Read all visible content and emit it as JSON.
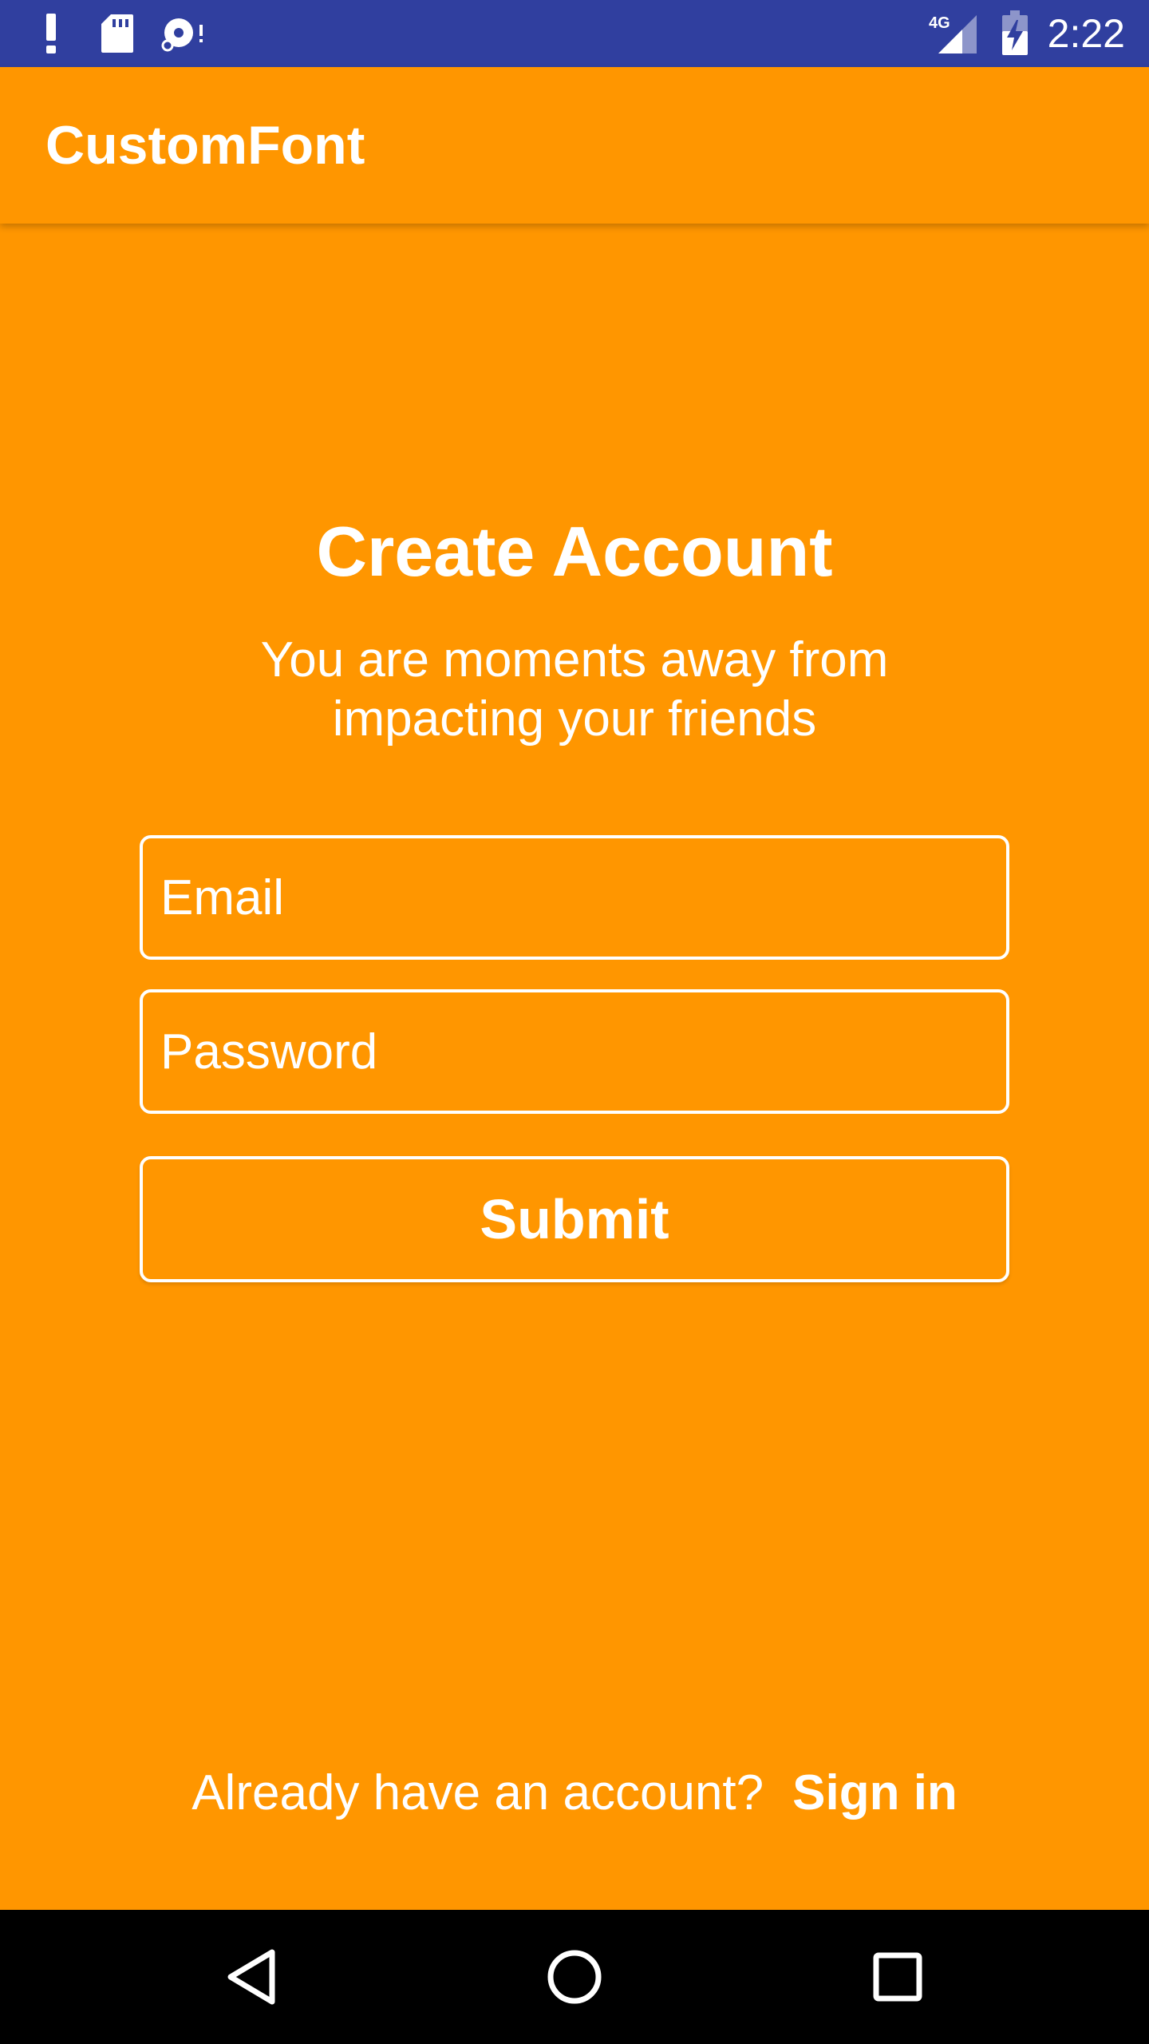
{
  "status_bar": {
    "time": "2:22",
    "network": "4G",
    "background_color": "#303F9F",
    "icons": [
      "alert-icon",
      "sd-card-icon",
      "disc-sync-icon",
      "signal-4g-icon",
      "battery-charging-icon"
    ]
  },
  "app_bar": {
    "title": "CustomFont"
  },
  "main": {
    "heading": "Create Account",
    "subtitle_line1": "You are moments away from",
    "subtitle_line2": "impacting your friends",
    "email": {
      "placeholder": "Email",
      "value": ""
    },
    "password": {
      "placeholder": "Password",
      "value": ""
    },
    "submit_label": "Submit"
  },
  "footer": {
    "prompt": "Already have an account?",
    "sign_in_label": "Sign in"
  },
  "nav_bar": {
    "buttons": [
      "back-icon",
      "home-icon",
      "recents-icon"
    ]
  },
  "colors": {
    "accent": "#FF9600",
    "text": "#FFFFFF",
    "nav_background": "#000000"
  }
}
